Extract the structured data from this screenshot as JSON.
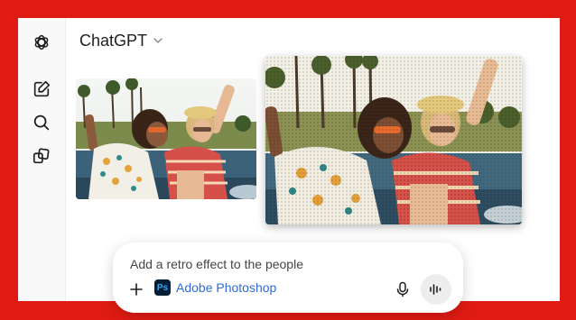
{
  "app": {
    "title": "ChatGPT"
  },
  "sidebar": {
    "items": [
      {
        "icon": "openai-logo-icon"
      },
      {
        "icon": "new-chat-icon"
      },
      {
        "icon": "search-icon"
      },
      {
        "icon": "library-icon"
      }
    ]
  },
  "images": [
    {
      "description": "original-photo",
      "icon": "photo"
    },
    {
      "description": "retro-effect-photo",
      "icon": "photo"
    }
  ],
  "composer": {
    "prompt": "Add a retro effect to the people",
    "tool_label": "Adobe Photoshop",
    "tool_logo_text": "Ps"
  },
  "colors": {
    "background_frame": "#e01b14",
    "accent_link": "#2e6bd8",
    "ps_dark": "#001e36",
    "ps_blue": "#31a8ff"
  }
}
